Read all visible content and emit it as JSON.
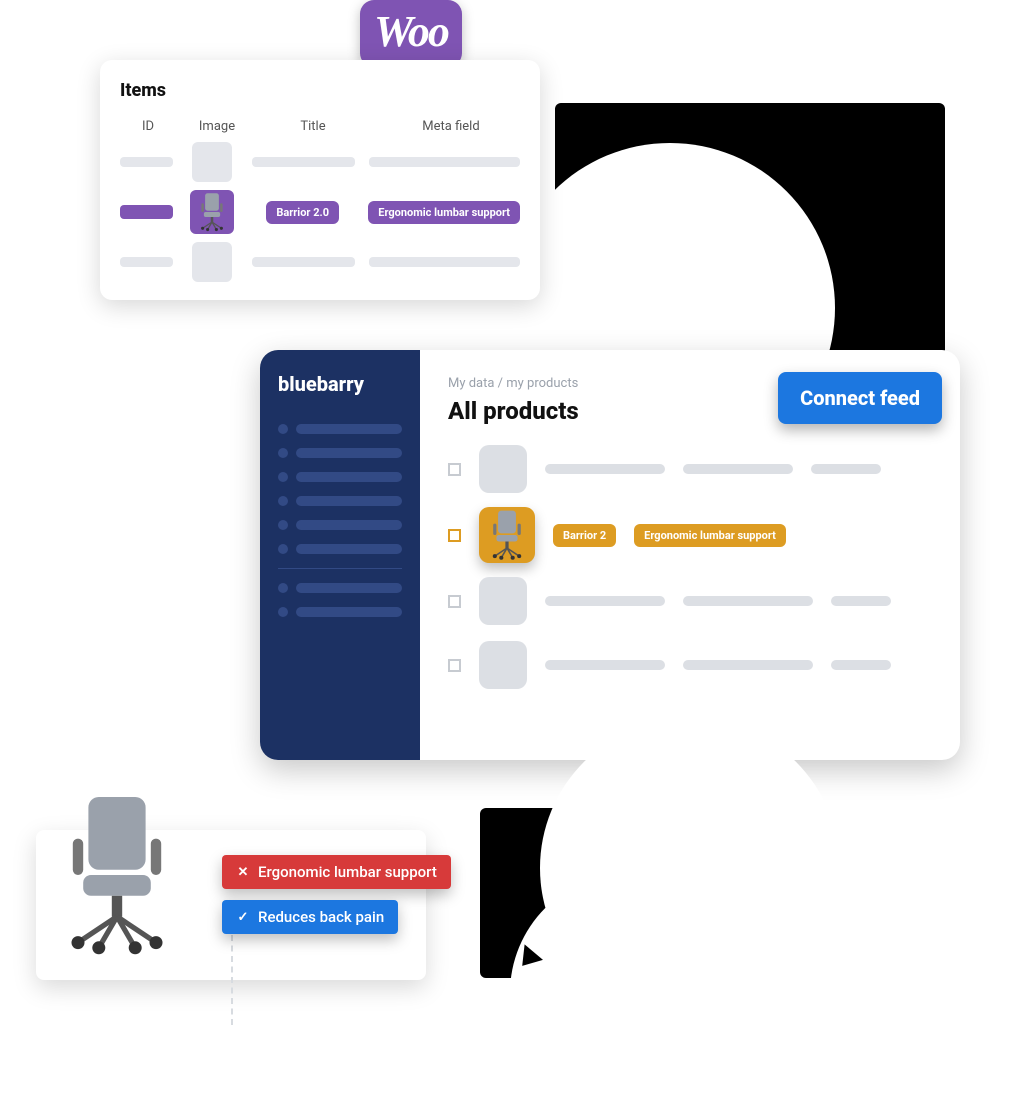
{
  "colors": {
    "woo_purple": "#7f54b3",
    "bluebarry_navy": "#1c3163",
    "accent_blue": "#1c77e0",
    "accent_amber": "#dd9c22",
    "tag_red": "#d73a3a"
  },
  "woo_badge": {
    "text": "Woo"
  },
  "items_card": {
    "title": "Items",
    "columns": {
      "id": "ID",
      "image": "Image",
      "title": "Title",
      "meta": "Meta field"
    },
    "selected_row": {
      "title_pill": "Barrior 2.0",
      "meta_pill": "Ergonomic lumbar support"
    }
  },
  "app": {
    "brand": "bluebarry",
    "breadcrumb": "My data / my products",
    "page_title": "All products",
    "connect_button": "Connect feed",
    "selected_row": {
      "title_pill": "Barrior 2",
      "meta_pill": "Ergonomic lumbar support"
    }
  },
  "result_tags": {
    "remove": "Ergonomic lumbar support",
    "add": "Reduces back pain"
  }
}
